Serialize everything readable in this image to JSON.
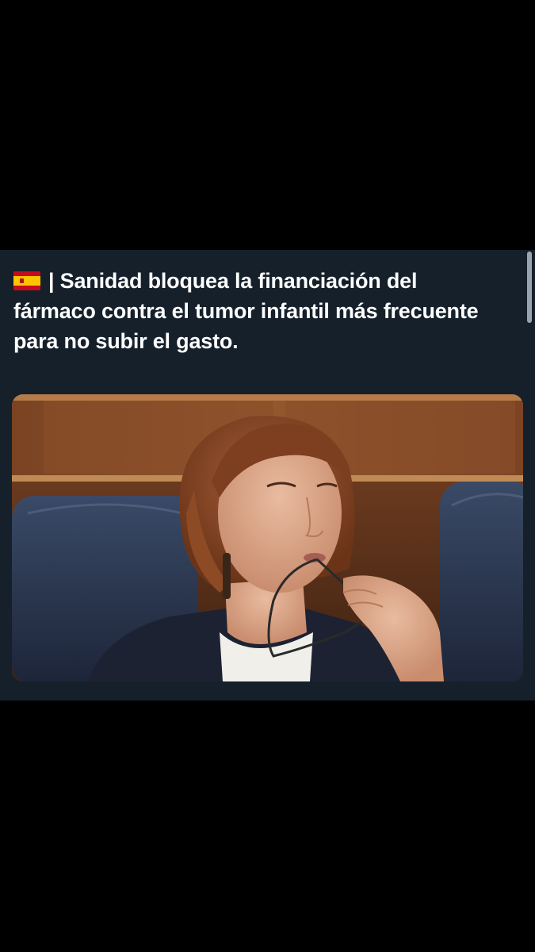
{
  "post": {
    "flag_icon": "spain-flag-icon",
    "headline": "| Sanidad bloquea la financiación del fármaco contra el tumor infantil más frecuente para no subir el gasto.",
    "colors": {
      "background": "#000000",
      "card": "#15202b",
      "text": "#ffffff"
    }
  }
}
